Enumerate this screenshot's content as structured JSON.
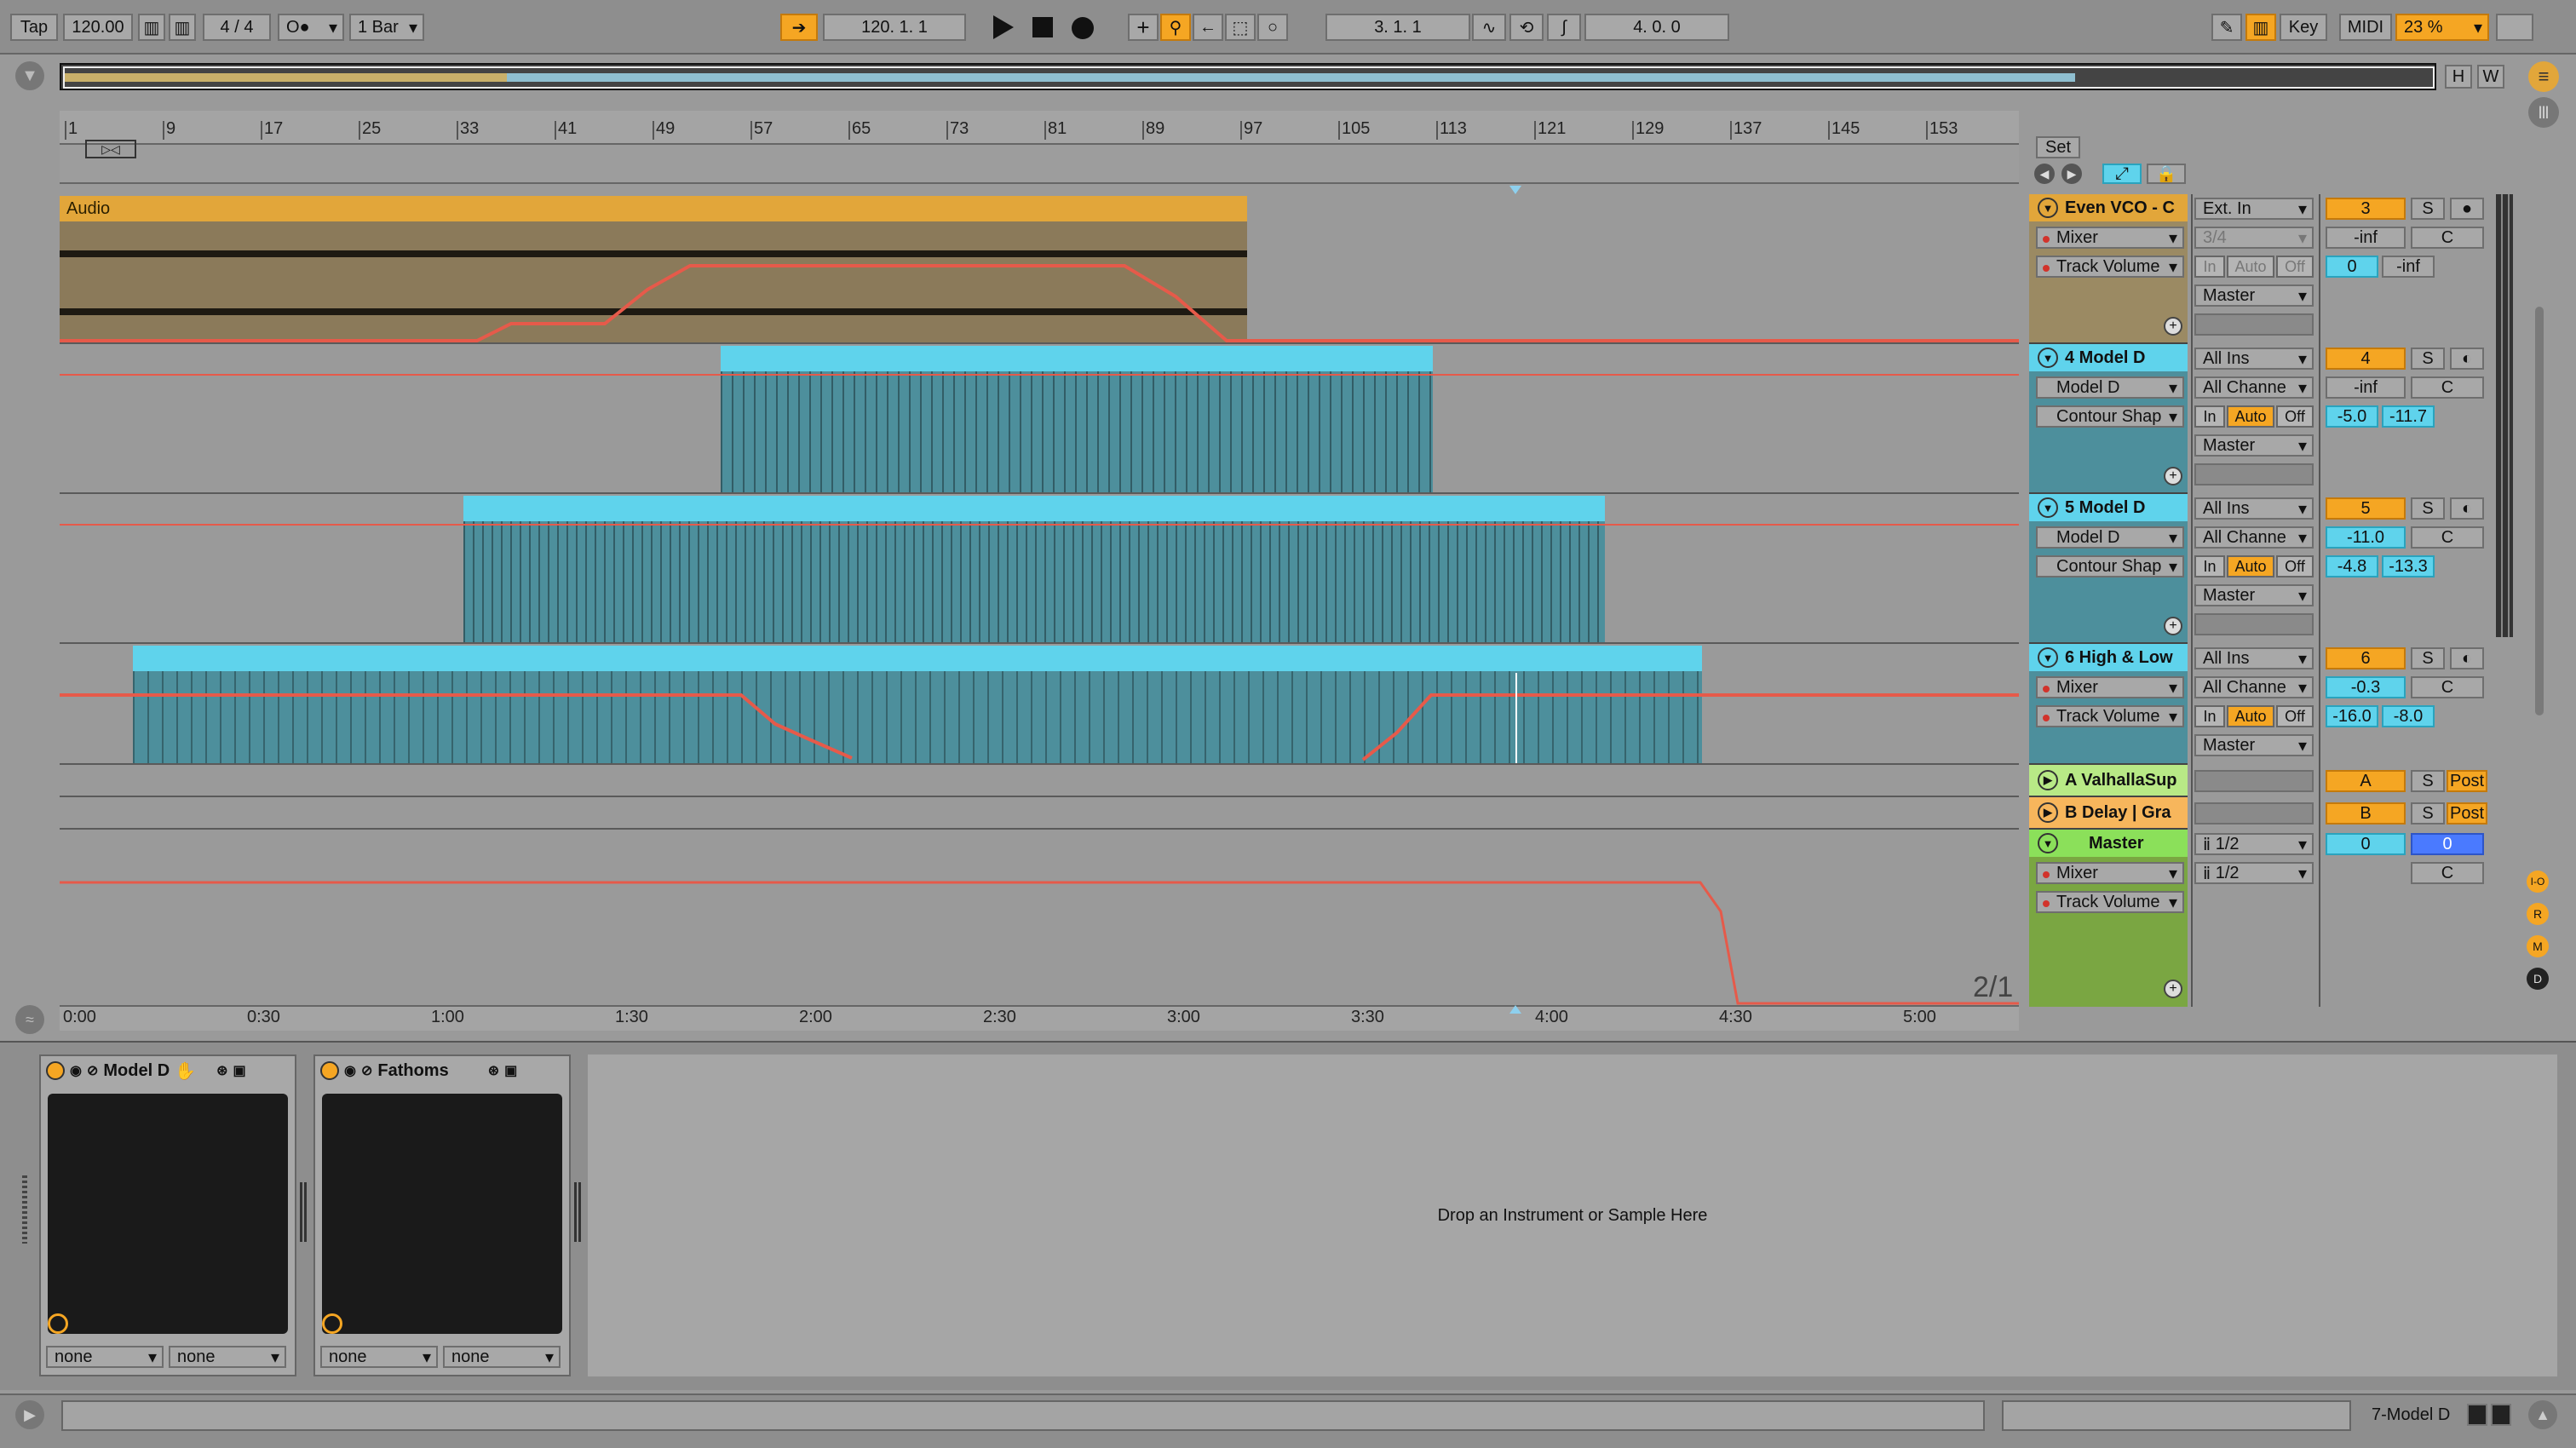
{
  "toolbar": {
    "tap": "Tap",
    "tempo": "120.00",
    "signature": "4 / 4",
    "quantize": "1 Bar",
    "position": "120.  1.  1",
    "loop_start": "3.  1.  1",
    "loop_length": "4.  0.  0",
    "key": "Key",
    "midi": "MIDI",
    "cpu": "23 %"
  },
  "overview": {
    "h": "H",
    "w": "W"
  },
  "ruler": {
    "bars": [
      "1",
      "9",
      "17",
      "25",
      "33",
      "41",
      "49",
      "57",
      "65",
      "73",
      "81",
      "89",
      "97",
      "105",
      "113",
      "121",
      "129",
      "137",
      "145",
      "153"
    ]
  },
  "timeline": {
    "times": [
      "0:00",
      "0:30",
      "1:00",
      "1:30",
      "2:00",
      "2:30",
      "3:00",
      "3:30",
      "4:00",
      "4:30",
      "5:00"
    ]
  },
  "set_label": "Set",
  "page_counter": "2/1",
  "tracks": [
    {
      "name": "Even VCO - C",
      "device": "Mixer",
      "param": "Track Volume",
      "input": "Ext. In",
      "channel": "3/4",
      "output": "Master",
      "number": "3",
      "volume": "-inf",
      "pan": "C",
      "send_a": "0",
      "send_b": "-inf",
      "clip_label": "Audio",
      "monitor": [
        "In",
        "Auto",
        "Off"
      ]
    },
    {
      "name": "4 Model D",
      "device": "Model D",
      "param": "Contour Shap",
      "input": "All Ins",
      "channel": "All Channe",
      "output": "Master",
      "number": "4",
      "volume": "-inf",
      "pan": "C",
      "send_a": "-5.0",
      "send_b": "-11.7",
      "monitor": [
        "In",
        "Auto",
        "Off"
      ]
    },
    {
      "name": "5 Model D",
      "device": "Model D",
      "param": "Contour Shap",
      "input": "All Ins",
      "channel": "All Channe",
      "output": "Master",
      "number": "5",
      "volume": "-11.0",
      "pan": "C",
      "send_a": "-4.8",
      "send_b": "-13.3",
      "monitor": [
        "In",
        "Auto",
        "Off"
      ]
    },
    {
      "name": "6 High & Low",
      "device": "Mixer",
      "param": "Track Volume",
      "input": "All Ins",
      "channel": "All Channe",
      "output": "Master",
      "number": "6",
      "volume": "-0.3",
      "pan": "C",
      "send_a": "-16.0",
      "send_b": "-8.0",
      "monitor": [
        "In",
        "Auto",
        "Off"
      ]
    }
  ],
  "returns": [
    {
      "name": "A ValhallaSup",
      "letter": "A",
      "solo": "S",
      "post": "Post"
    },
    {
      "name": "B Delay | Gra",
      "letter": "B",
      "solo": "S",
      "post": "Post"
    }
  ],
  "master": {
    "name": "Master",
    "device": "Mixer",
    "param": "Track Volume",
    "cue_out": "1/2",
    "main_out": "1/2",
    "volume": "0",
    "cue": "0",
    "pan": "C"
  },
  "solo_label": "S",
  "devices": [
    {
      "name": "Model D",
      "sel1": "none",
      "sel2": "none"
    },
    {
      "name": "Fathoms",
      "sel1": "none",
      "sel2": "none"
    }
  ],
  "drop_hint": "Drop an Instrument or Sample Here",
  "status": {
    "selected_track": "7-Model D"
  },
  "side_buttons": [
    "I-O",
    "R",
    "M",
    "D"
  ],
  "colors": {
    "audio_clip": "#e2a63a",
    "midi_clip": "#5fd3ec",
    "clip_body": "#4d8f9c",
    "automation": "#e65a4a",
    "accent": "#f5a623"
  }
}
